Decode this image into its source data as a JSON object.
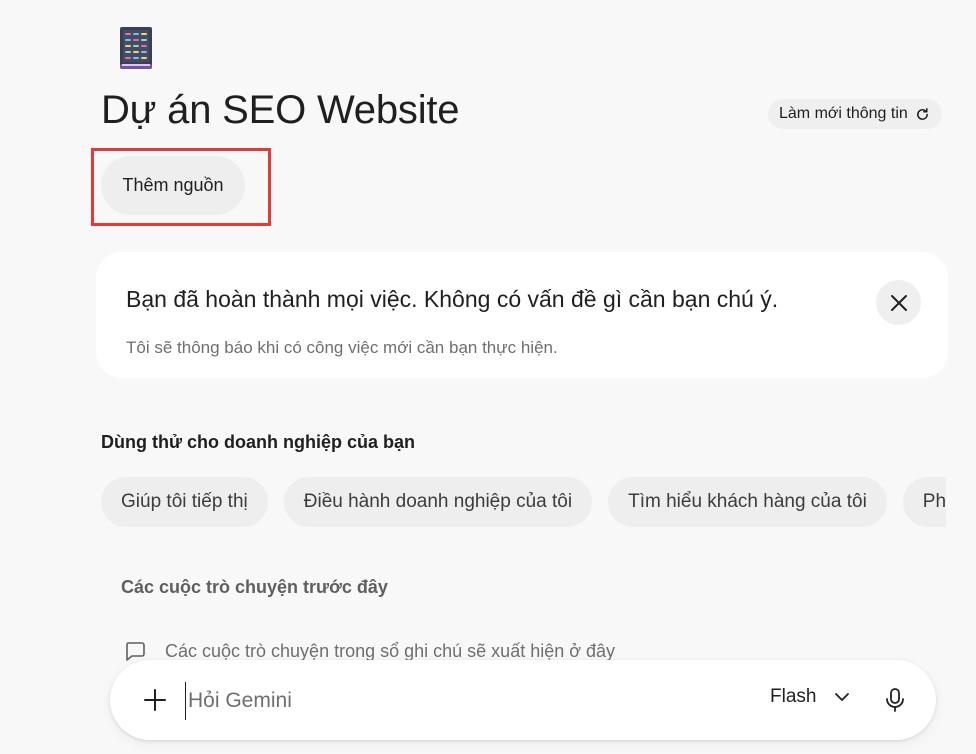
{
  "notebook": {
    "icon": "book-icon",
    "title": "Dự án SEO Website",
    "refresh_label": "Làm mới thông tin",
    "add_source_label": "Thêm nguồn"
  },
  "notice": {
    "title": "Bạn đã hoàn thành mọi việc. Không có vấn đề gì cần bạn chú ý.",
    "subtitle": "Tôi sẽ thông báo khi có công việc mới cần bạn thực hiện."
  },
  "suggestions": {
    "heading": "Dùng thử cho doanh nghiệp của bạn",
    "chips": [
      {
        "label": "Giúp tôi tiếp thị"
      },
      {
        "label": "Điều hành doanh nghiệp của tôi"
      },
      {
        "label": "Tìm hiểu khách hàng của tôi"
      },
      {
        "label": "Phá"
      }
    ]
  },
  "previous_chats": {
    "heading": "Các cuộc trò chuyện trước đây",
    "empty_text": "Các cuộc trò chuyện trong sổ ghi chú sẽ xuất hiện ở đây"
  },
  "composer": {
    "placeholder": "Hỏi Gemini",
    "model": "Flash"
  },
  "colors": {
    "highlight": "#e53935",
    "card": "#ffffff",
    "chip": "#eeeeee",
    "background": "#f8f8f8"
  }
}
